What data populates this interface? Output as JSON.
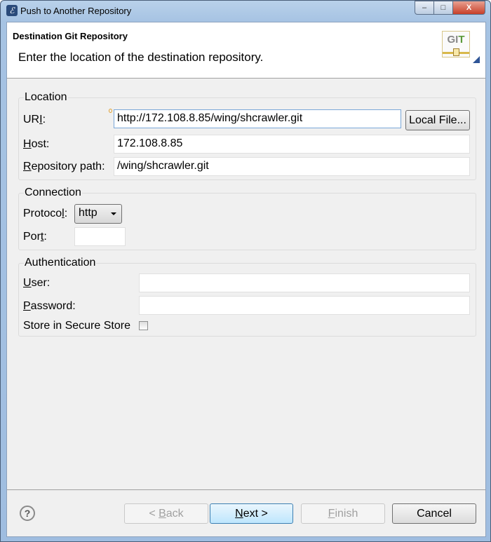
{
  "window": {
    "title": "Push to Another Repository",
    "minimize": "–",
    "maximize": "□",
    "close": "X"
  },
  "header": {
    "title": "Destination Git Repository",
    "description": "Enter the location of the destination repository.",
    "logo_text": "GIT"
  },
  "location": {
    "legend": "Location",
    "uri": {
      "label": [
        "UR",
        "I",
        ":"
      ],
      "value": "http://172.108.8.85/wing/shcrawler.git"
    },
    "local_file_button": "Local File...",
    "host": {
      "label": [
        "",
        "H",
        "ost:"
      ],
      "value": "172.108.8.85"
    },
    "repo_path": {
      "label": [
        "",
        "R",
        "epository path:"
      ],
      "value": "/wing/shcrawler.git"
    }
  },
  "connection": {
    "legend": "Connection",
    "protocol": {
      "label": [
        "Protoco",
        "l",
        ":"
      ],
      "value": "http"
    },
    "port": {
      "label": [
        "Por",
        "t",
        ":"
      ],
      "value": ""
    }
  },
  "authentication": {
    "legend": "Authentication",
    "user": {
      "label": [
        "",
        "U",
        "ser:"
      ],
      "value": ""
    },
    "password": {
      "label": [
        "",
        "P",
        "assword:"
      ],
      "value": ""
    },
    "store": {
      "label": "Store in Secure Store",
      "checked": false
    }
  },
  "footer": {
    "help_icon": "?",
    "back": [
      "< ",
      "B",
      "ack"
    ],
    "next": [
      "",
      "N",
      "ext >"
    ],
    "finish": [
      "",
      "F",
      "inish"
    ],
    "cancel": "Cancel"
  }
}
